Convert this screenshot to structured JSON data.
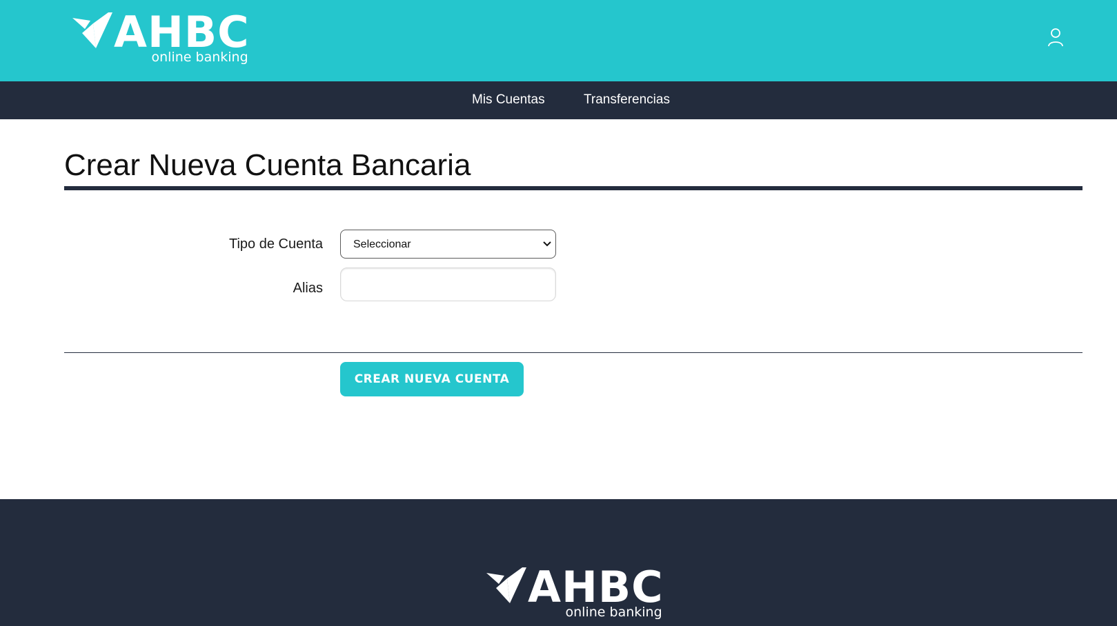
{
  "header": {
    "logo": {
      "word": "AHBC",
      "subtitle": "online banking"
    },
    "user_icon": "user-icon"
  },
  "nav": {
    "items": [
      {
        "label": "Mis Cuentas"
      },
      {
        "label": "Transferencias"
      }
    ]
  },
  "main": {
    "title": "Crear Nueva Cuenta Bancaria",
    "form": {
      "tipo_label": "Tipo de Cuenta",
      "tipo_selected": "Seleccionar",
      "alias_label": "Alias",
      "alias_value": "",
      "submit_label": "CREAR NUEVA CUENTA"
    }
  },
  "footer": {
    "logo": {
      "word": "AHBC",
      "subtitle": "online banking"
    }
  },
  "colors": {
    "brand_teal": "#25c6cd",
    "navy": "#232c3d",
    "background": "#ffffff"
  }
}
